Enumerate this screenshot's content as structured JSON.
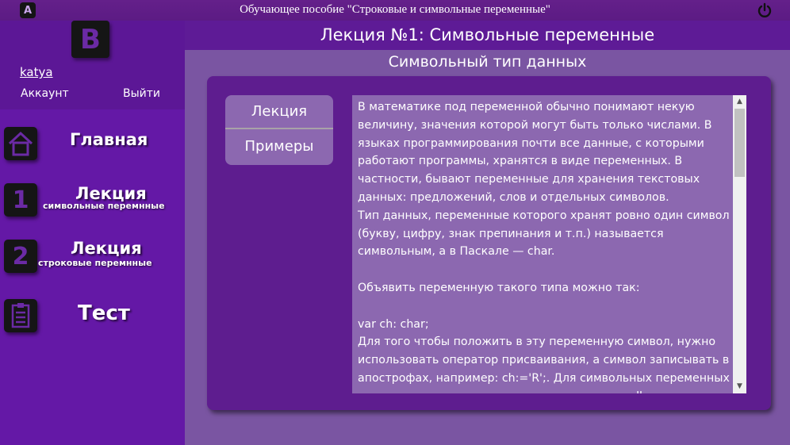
{
  "window": {
    "title": "Обучающее пособие \"Строковые и символьные переменные\"",
    "badge": "A"
  },
  "sidebar": {
    "logo": "B",
    "username": "katya",
    "account_label": "Аккаунт",
    "logout_label": "Выйти",
    "items": [
      {
        "label": "Главная",
        "sub": "",
        "icon": "home-icon"
      },
      {
        "label": "Лекция",
        "sub": "символьные перемнные",
        "badge": "1",
        "icon": "number-one-icon"
      },
      {
        "label": "Лекция",
        "sub": "строковые перемнные",
        "badge": "2",
        "icon": "number-two-icon"
      },
      {
        "label": "Тест",
        "sub": "",
        "icon": "clipboard-icon"
      }
    ]
  },
  "main": {
    "header": "Лекция №1: Символьные переменные",
    "section_title": "Символьный тип данных",
    "tabs": [
      {
        "label": "Лекция"
      },
      {
        "label": "Примеры"
      }
    ],
    "content": [
      "В математике под переменной обычно понимают некую величину, значения которой могут быть только числами. В языках программирования почти все данные, с которыми работают программы, хранятся в виде переменных. В частности, бывают переменные для хранения текстовых данных: предложений, слов и отдельных символов.",
      "Тип данных, переменные которого хранят ровно один символ (букву, цифру, знак препинания и т.п.) называется символьным, а в Паскале — char.",
      "",
      "Объявить переменную такого типа можно так:",
      "",
      "var ch: char;",
      "Для того чтобы положить в эту переменную символ, нужно использовать оператор присваивания, а символ записывать в апострофах, например: ch:='R';. Для символьных переменных также возможно использовать процедуру readln, например:"
    ]
  },
  "colors": {
    "sidebar_bg": "#6418a6",
    "main_bg": "#7a55a2",
    "panel_bg": "#5e1d8f",
    "text_area_bg": "#8c68b0"
  }
}
